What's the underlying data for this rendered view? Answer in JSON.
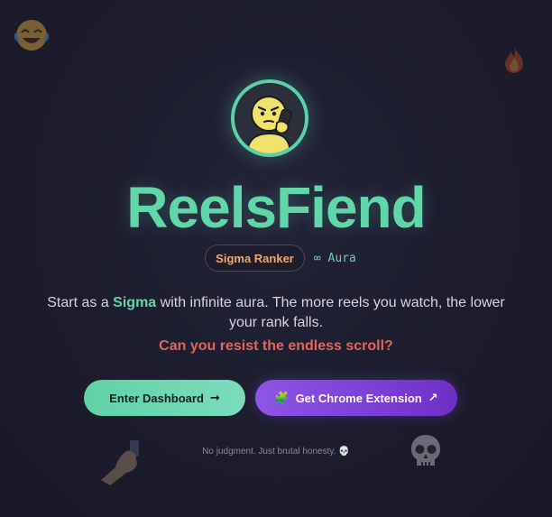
{
  "hero": {
    "app_name": "ReelsFiend",
    "rank_badge": "Sigma Ranker",
    "aura_label": "∞ Aura",
    "description_prefix": "Start as a ",
    "description_highlight": "Sigma",
    "description_suffix": " with infinite aura. The more reels you watch, the lower your rank falls.",
    "tagline": "Can you resist the endless scroll?"
  },
  "actions": {
    "dashboard_label": "Enter Dashboard",
    "dashboard_icon": "arrow-right-icon",
    "dashboard_glyph": "→",
    "extension_label": "Get Chrome Extension",
    "extension_emoji": "🧩",
    "extension_icon": "external-arrow-icon",
    "extension_glyph": "↗"
  },
  "footer": {
    "note": "No judgment. Just brutal honesty.",
    "note_emoji": "💀"
  },
  "colors": {
    "accent_green": "#62d6ab",
    "accent_purple": "#8f55e6",
    "tagline_red": "#e0655f",
    "badge_orange": "#f1a86a",
    "background": "#1c1c2e"
  }
}
